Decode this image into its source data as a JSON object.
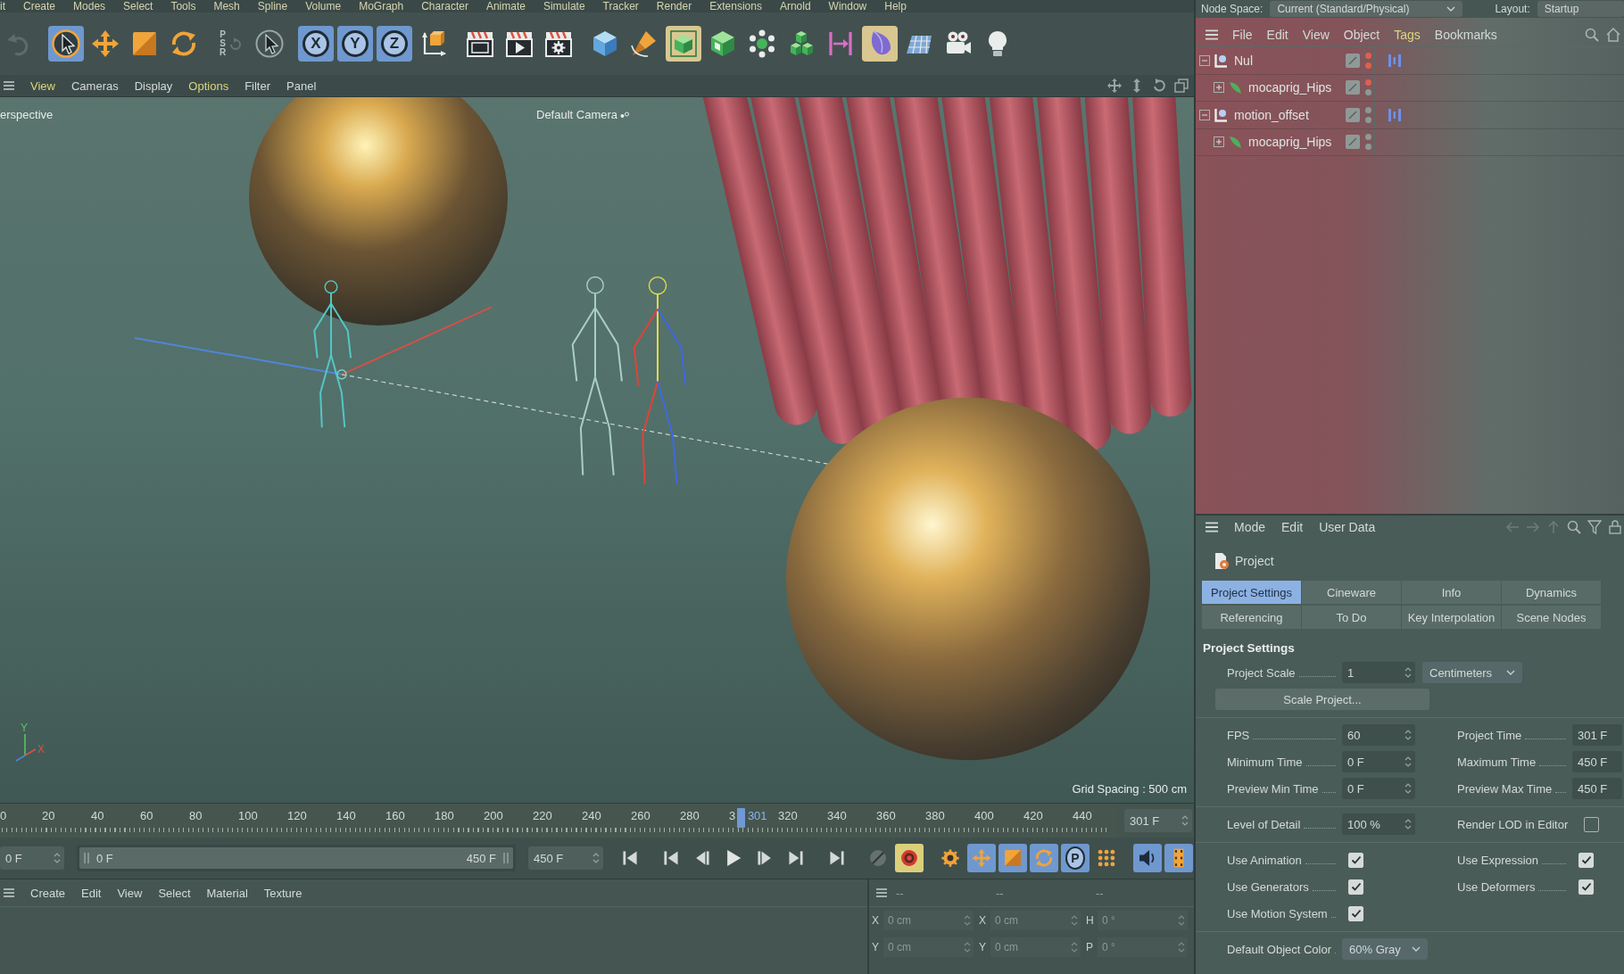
{
  "menu_bar": {
    "items": [
      "it",
      "Create",
      "Modes",
      "Select",
      "Tools",
      "Mesh",
      "Spline",
      "Volume",
      "MoGraph",
      "Character",
      "Animate",
      "Simulate",
      "Tracker",
      "Render",
      "Extensions",
      "Arnold",
      "Window",
      "Help"
    ]
  },
  "toolbar": {
    "groups": [
      [
        {
          "kind": "undo",
          "selected": false,
          "disabled": true
        }
      ],
      [
        {
          "kind": "select",
          "selected": true,
          "disabled": false
        },
        {
          "kind": "move",
          "selected": false,
          "disabled": false
        },
        {
          "kind": "scale",
          "selected": false,
          "disabled": false
        },
        {
          "kind": "rotate",
          "selected": false,
          "disabled": false
        }
      ],
      [
        {
          "kind": "psr",
          "label": "PSR",
          "selected": false,
          "disabled": true
        },
        {
          "kind": "live-select",
          "selected": false,
          "disabled": false
        }
      ],
      [
        {
          "kind": "axis",
          "label": "X",
          "selected": true,
          "disabled": false
        },
        {
          "kind": "axis",
          "label": "Y",
          "selected": true,
          "disabled": false
        },
        {
          "kind": "axis",
          "label": "Z",
          "selected": true,
          "disabled": false
        },
        {
          "kind": "coordinate-system",
          "selected": false,
          "disabled": false
        }
      ],
      [
        {
          "kind": "render-region",
          "selected": false,
          "disabled": false
        },
        {
          "kind": "render-view",
          "selected": false,
          "disabled": false
        },
        {
          "kind": "render-settings",
          "selected": false,
          "disabled": false
        }
      ],
      [
        {
          "kind": "cube",
          "selected": false,
          "disabled": false
        },
        {
          "kind": "pen",
          "selected": false,
          "disabled": false
        },
        {
          "kind": "subdivision",
          "selected": true,
          "disabled": false
        },
        {
          "kind": "generator",
          "selected": false,
          "disabled": false
        },
        {
          "kind": "cloner",
          "selected": false,
          "disabled": false
        },
        {
          "kind": "cubes",
          "selected": false,
          "disabled": false
        },
        {
          "kind": "deformer",
          "selected": false,
          "disabled": false
        },
        {
          "kind": "field",
          "selected": true,
          "disabled": false
        },
        {
          "kind": "floor",
          "selected": false,
          "disabled": false
        },
        {
          "kind": "camera",
          "selected": false,
          "disabled": false
        },
        {
          "kind": "light",
          "selected": false,
          "disabled": false
        }
      ]
    ]
  },
  "viewport": {
    "menu": [
      {
        "label": "View",
        "highlighted": true
      },
      {
        "label": "Cameras",
        "highlighted": false
      },
      {
        "label": "Display",
        "highlighted": false
      },
      {
        "label": "Options",
        "highlighted": true
      },
      {
        "label": "Filter",
        "highlighted": false
      },
      {
        "label": "Panel",
        "highlighted": false
      }
    ],
    "view_name": "erspective",
    "camera": "Default Camera",
    "axis_labels": [
      "Y",
      "X"
    ],
    "grid_spacing": "Grid Spacing : 500 cm"
  },
  "timeline": {
    "ruler_labels": [
      "0",
      "20",
      "40",
      "60",
      "80",
      "100",
      "120",
      "140",
      "160",
      "180",
      "200",
      "220",
      "240",
      "260",
      "280",
      "3",
      "320",
      "340",
      "360",
      "380",
      "400",
      "420",
      "440"
    ],
    "playhead": {
      "label": "301",
      "level": 0.669
    },
    "current_frame": "301 F",
    "start_field": "0 F",
    "range": {
      "start": "0 F",
      "end": "450 F",
      "level": 1
    },
    "end_field": "450 F",
    "transport": [
      [
        {
          "kind": "first",
          "selected": false
        }
      ],
      [
        {
          "kind": "prev-key",
          "selected": false
        },
        {
          "kind": "prev-frame",
          "selected": false
        },
        {
          "kind": "play",
          "selected": false
        },
        {
          "kind": "next-frame",
          "selected": false
        },
        {
          "kind": "next-key",
          "selected": false
        }
      ],
      [
        {
          "kind": "last",
          "selected": false
        }
      ],
      [
        {
          "kind": "autokey",
          "selected": false
        },
        {
          "kind": "record",
          "selected": true
        }
      ],
      [
        {
          "kind": "key-pla",
          "selected": false
        },
        {
          "kind": "key-move",
          "selected": true
        },
        {
          "kind": "key-scale",
          "selected": true
        },
        {
          "kind": "key-rotate",
          "selected": true
        },
        {
          "kind": "key-param",
          "label": "P",
          "selected": true
        },
        {
          "kind": "key-points",
          "selected": false
        }
      ],
      [
        {
          "kind": "sound",
          "selected": true
        },
        {
          "kind": "film",
          "selected": true
        }
      ]
    ]
  },
  "materials": {
    "menu": [
      "Create",
      "Edit",
      "View",
      "Select",
      "Material",
      "Texture"
    ]
  },
  "coordinates": {
    "headers": [
      "--",
      "--",
      "--"
    ],
    "rows": [
      [
        {
          "axis": "X",
          "value": "0 cm",
          "disabled": true
        },
        {
          "axis": "X",
          "value": "0 cm",
          "disabled": true
        },
        {
          "axis": "H",
          "value": "0 °",
          "disabled": true
        }
      ],
      [
        {
          "axis": "Y",
          "value": "0 cm",
          "disabled": true
        },
        {
          "axis": "Y",
          "value": "0 cm",
          "disabled": true
        },
        {
          "axis": "P",
          "value": "0 °",
          "disabled": true
        }
      ]
    ]
  },
  "header": {
    "node_space_label": "Node Space:",
    "node_space": "Current (Standard/Physical)",
    "layout_label": "Layout:",
    "layout": "Startup"
  },
  "object_manager": {
    "menu": [
      {
        "label": "File",
        "highlighted": false
      },
      {
        "label": "Edit",
        "highlighted": false
      },
      {
        "label": "View",
        "highlighted": false
      },
      {
        "label": "Object",
        "highlighted": false
      },
      {
        "label": "Tags",
        "highlighted": true
      },
      {
        "label": "Bookmarks",
        "highlighted": false
      }
    ],
    "objects": [
      {
        "name": "Nul",
        "kind": "null",
        "expanded": true,
        "tagged": true,
        "dots": [
          {
            "color": "#e0604f"
          },
          {
            "color": "#e0604f"
          }
        ],
        "children": [
          {
            "name": "mocaprig_Hips",
            "kind": "joint",
            "expanded": false,
            "tagged": false,
            "dots": [
              {
                "color": "#e0604f"
              },
              {
                "color": "#8d9996"
              }
            ]
          }
        ]
      },
      {
        "name": "motion_offset",
        "kind": "null",
        "expanded": true,
        "tagged": true,
        "dots": [
          {
            "color": "#8d9996"
          },
          {
            "color": "#8d9996"
          }
        ],
        "children": [
          {
            "name": "mocaprig_Hips",
            "kind": "joint",
            "expanded": false,
            "tagged": false,
            "dots": [
              {
                "color": "#8d9996"
              },
              {
                "color": "#8d9996"
              }
            ]
          }
        ]
      }
    ]
  },
  "attributes": {
    "menu": [
      "Mode",
      "Edit",
      "User Data"
    ],
    "object": "Project",
    "tabs": [
      {
        "label": "Project Settings",
        "selected": true
      },
      {
        "label": "Cineware",
        "selected": false
      },
      {
        "label": "Info",
        "selected": false
      },
      {
        "label": "Dynamics",
        "selected": false
      },
      {
        "label": "Referencing",
        "selected": false
      },
      {
        "label": "To Do",
        "selected": false
      },
      {
        "label": "Key Interpolation",
        "selected": false
      },
      {
        "label": "Scene Nodes",
        "selected": false
      }
    ],
    "section": "Project Settings",
    "groups": [
      [
        [
          {
            "kind": "number",
            "label": "Project Scale",
            "value": "1",
            "unit": "Centimeters"
          }
        ],
        [
          {
            "kind": "button",
            "label": "Scale Project..."
          }
        ]
      ],
      [
        [
          {
            "kind": "number",
            "label": "FPS",
            "value": "60"
          },
          {
            "kind": "number",
            "label": "Project Time",
            "value": "301 F"
          }
        ],
        [
          {
            "kind": "number",
            "label": "Minimum Time",
            "value": "0 F"
          },
          {
            "kind": "number",
            "label": "Maximum Time",
            "value": "450 F"
          }
        ],
        [
          {
            "kind": "number",
            "label": "Preview Min Time",
            "value": "0 F"
          },
          {
            "kind": "number",
            "label": "Preview Max Time",
            "value": "450 F"
          }
        ]
      ],
      [
        [
          {
            "kind": "number",
            "label": "Level of Detail",
            "value": "100 %"
          },
          {
            "kind": "checkbox",
            "label": "Render LOD in Editor",
            "checked": false
          }
        ]
      ],
      [
        [
          {
            "kind": "checkbox",
            "label": "Use Animation",
            "checked": true
          },
          {
            "kind": "checkbox",
            "label": "Use Expression",
            "checked": true
          }
        ],
        [
          {
            "kind": "checkbox",
            "label": "Use Generators",
            "checked": true
          },
          {
            "kind": "checkbox",
            "label": "Use Deformers",
            "checked": true
          }
        ],
        [
          {
            "kind": "checkbox",
            "label": "Use Motion System",
            "checked": true
          }
        ]
      ],
      [
        [
          {
            "kind": "dropdown",
            "label": "Default Object Color",
            "value": "60% Gray"
          }
        ]
      ]
    ]
  }
}
